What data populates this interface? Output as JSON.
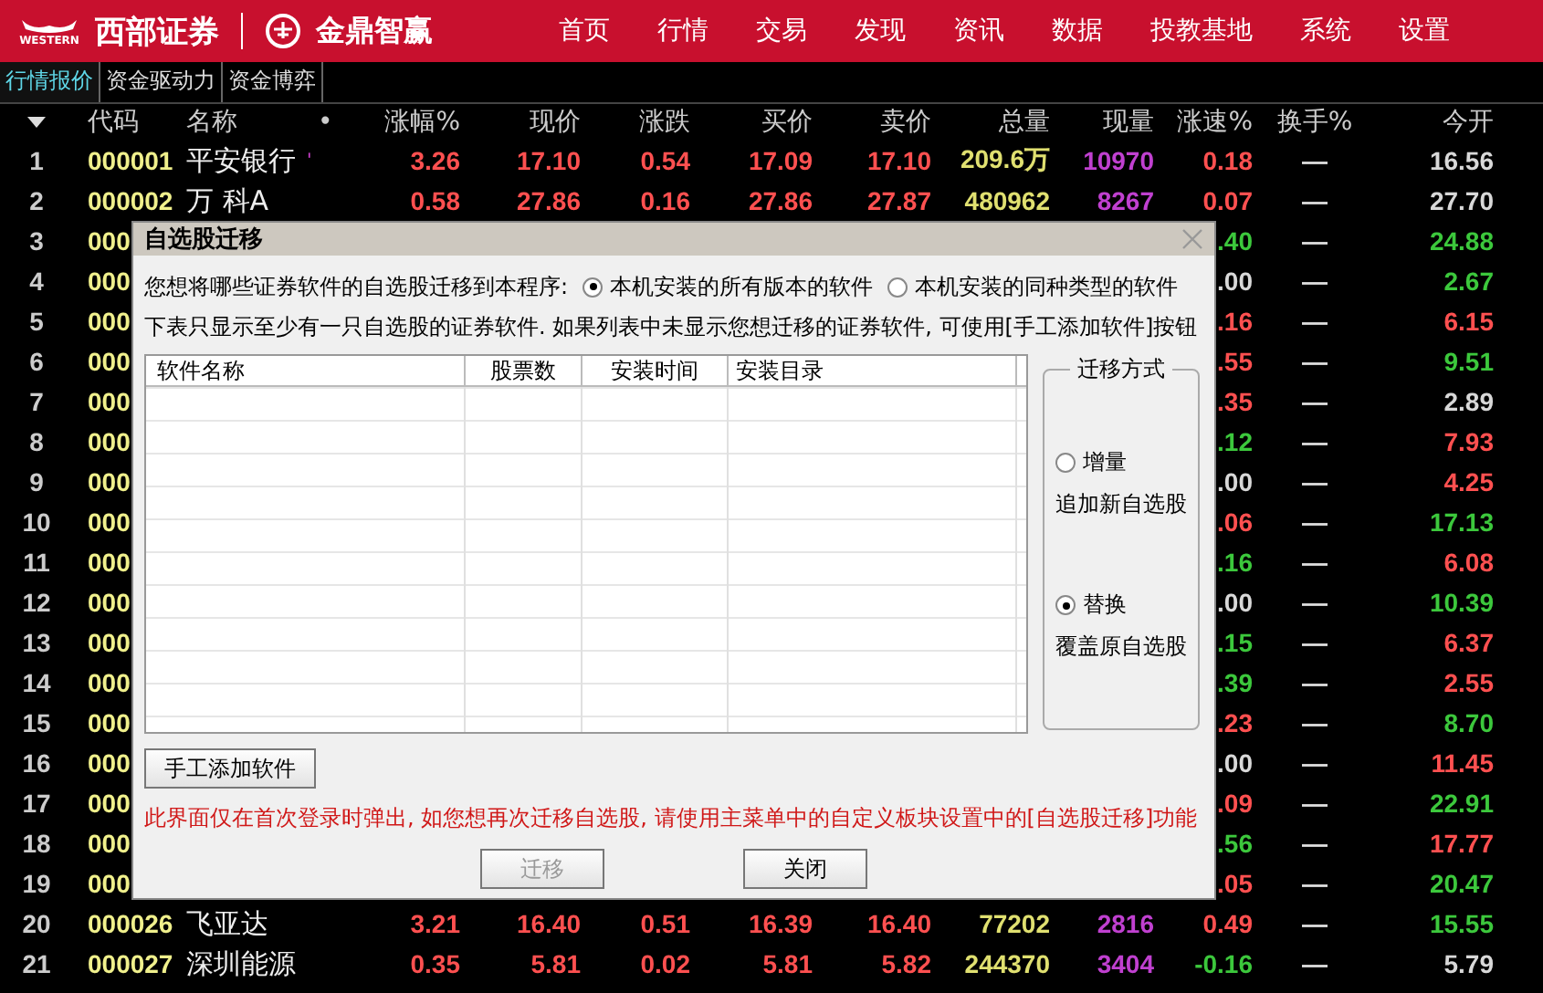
{
  "header": {
    "brand_small": "WESTERN",
    "brand": "西部证券",
    "product": "金鼎智赢",
    "nav": [
      "首页",
      "行情",
      "交易",
      "发现",
      "资讯",
      "数据",
      "投教基地",
      "系统",
      "设置"
    ]
  },
  "tabs": [
    {
      "label": "行情报价",
      "selected": true
    },
    {
      "label": "资金驱动力",
      "selected": false
    },
    {
      "label": "资金博弈",
      "selected": false
    }
  ],
  "table": {
    "columns": [
      "代码",
      "名称",
      "•",
      "涨幅%",
      "现价",
      "涨跌",
      "买价",
      "卖价",
      "总量",
      "现量",
      "涨速%",
      "换手%",
      "今开"
    ],
    "rows": [
      {
        "num": "1",
        "code": "000001",
        "name": "平安银行",
        "flag": "'",
        "color": "#ff5050",
        "chg_pct": "3.26",
        "price": "17.10",
        "chg": "0.54",
        "bid": "17.09",
        "ask": "17.10",
        "volume": "209.6万",
        "cur_vol": "10970",
        "speed": {
          "text": "0.18",
          "color": "#ff5050"
        },
        "turnover": "—",
        "open": {
          "text": "16.56",
          "color": "#d8d8d8"
        }
      },
      {
        "num": "2",
        "code": "000002",
        "name": "万 科A",
        "color": "#ff5050",
        "chg_pct": "0.58",
        "price": "27.86",
        "chg": "0.16",
        "bid": "27.86",
        "ask": "27.87",
        "volume": "480962",
        "cur_vol": "8267",
        "speed": {
          "text": "0.07",
          "color": "#ff5050"
        },
        "turnover": "—",
        "open": {
          "text": "27.70",
          "color": "#d8d8d8"
        }
      },
      {
        "num": "3",
        "code": "000",
        "speed": {
          "text": ".40",
          "color": "#3cc83c"
        },
        "turnover": "—",
        "open": {
          "text": "24.88",
          "color": "#3cc83c"
        }
      },
      {
        "num": "4",
        "code": "000",
        "speed": {
          "text": ".00",
          "color": "#d8d8d8"
        },
        "turnover": "—",
        "open": {
          "text": "2.67",
          "color": "#3cc83c"
        }
      },
      {
        "num": "5",
        "code": "000",
        "speed": {
          "text": ".16",
          "color": "#ff5050"
        },
        "turnover": "—",
        "open": {
          "text": "6.15",
          "color": "#ff5050"
        }
      },
      {
        "num": "6",
        "code": "000",
        "speed": {
          "text": ".55",
          "color": "#ff5050"
        },
        "turnover": "—",
        "open": {
          "text": "9.51",
          "color": "#3cc83c"
        }
      },
      {
        "num": "7",
        "code": "000",
        "speed": {
          "text": ".35",
          "color": "#ff5050"
        },
        "turnover": "—",
        "open": {
          "text": "2.89",
          "color": "#d8d8d8"
        }
      },
      {
        "num": "8",
        "code": "000",
        "speed": {
          "text": ".12",
          "color": "#3cc83c"
        },
        "turnover": "—",
        "open": {
          "text": "7.93",
          "color": "#ff5050"
        }
      },
      {
        "num": "9",
        "code": "000",
        "speed": {
          "text": ".00",
          "color": "#d8d8d8"
        },
        "turnover": "—",
        "open": {
          "text": "4.25",
          "color": "#ff5050"
        }
      },
      {
        "num": "10",
        "code": "000",
        "speed": {
          "text": ".06",
          "color": "#ff5050"
        },
        "turnover": "—",
        "open": {
          "text": "17.13",
          "color": "#3cc83c"
        }
      },
      {
        "num": "11",
        "code": "000",
        "speed": {
          "text": ".16",
          "color": "#3cc83c"
        },
        "turnover": "—",
        "open": {
          "text": "6.08",
          "color": "#ff5050"
        }
      },
      {
        "num": "12",
        "code": "000",
        "speed": {
          "text": ".00",
          "color": "#d8d8d8"
        },
        "turnover": "—",
        "open": {
          "text": "10.39",
          "color": "#3cc83c"
        }
      },
      {
        "num": "13",
        "code": "000",
        "speed": {
          "text": ".15",
          "color": "#3cc83c"
        },
        "turnover": "—",
        "open": {
          "text": "6.37",
          "color": "#ff5050"
        }
      },
      {
        "num": "14",
        "code": "000",
        "speed": {
          "text": ".39",
          "color": "#3cc83c"
        },
        "turnover": "—",
        "open": {
          "text": "2.55",
          "color": "#ff5050"
        }
      },
      {
        "num": "15",
        "code": "000",
        "speed": {
          "text": ".23",
          "color": "#ff5050"
        },
        "turnover": "—",
        "open": {
          "text": "8.70",
          "color": "#3cc83c"
        }
      },
      {
        "num": "16",
        "code": "000",
        "speed": {
          "text": ".00",
          "color": "#d8d8d8"
        },
        "turnover": "—",
        "open": {
          "text": "11.45",
          "color": "#ff5050"
        }
      },
      {
        "num": "17",
        "code": "000",
        "speed": {
          "text": ".09",
          "color": "#ff5050"
        },
        "turnover": "—",
        "open": {
          "text": "22.91",
          "color": "#3cc83c"
        }
      },
      {
        "num": "18",
        "code": "000",
        "speed": {
          "text": ".56",
          "color": "#3cc83c"
        },
        "turnover": "—",
        "open": {
          "text": "17.77",
          "color": "#ff5050"
        }
      },
      {
        "num": "19",
        "code": "000",
        "speed": {
          "text": ".05",
          "color": "#ff5050"
        },
        "turnover": "—",
        "open": {
          "text": "20.47",
          "color": "#3cc83c"
        }
      },
      {
        "num": "20",
        "code": "000026",
        "name": "飞亚达",
        "color": "#ff5050",
        "chg_pct": "3.21",
        "price": "16.40",
        "chg": "0.51",
        "bid": "16.39",
        "ask": "16.40",
        "volume": "77202",
        "cur_vol": "2816",
        "speed": {
          "text": "0.49",
          "color": "#ff5050"
        },
        "turnover": "—",
        "open": {
          "text": "15.55",
          "color": "#3cc83c"
        }
      },
      {
        "num": "21",
        "code": "000027",
        "name": "深圳能源",
        "color": "#ff5050",
        "chg_pct": "0.35",
        "price": "5.81",
        "chg": "0.02",
        "bid": "5.81",
        "ask": "5.82",
        "volume": "244370",
        "cur_vol": "3404",
        "speed": {
          "text": "-0.16",
          "color": "#3cc83c"
        },
        "turnover": "—",
        "open": {
          "text": "5.79",
          "color": "#d8d8d8"
        }
      }
    ]
  },
  "dialog": {
    "title": "自选股迁移",
    "prompt": "您想将哪些证券软件的自选股迁移到本程序:",
    "sources": [
      {
        "label": "本机安装的所有版本的软件",
        "selected": true
      },
      {
        "label": "本机安装的同种类型的软件",
        "selected": false
      }
    ],
    "hint": "下表只显示至少有一只自选股的证券软件. 如果列表中未显示您想迁移的证券软件, 可使用[手工添加软件]按钮",
    "list_columns": [
      "软件名称",
      "股票数",
      "安装时间",
      "安装目录"
    ],
    "mode": {
      "title": "迁移方式",
      "options": [
        {
          "label": "增量",
          "description": "追加新自选股",
          "selected": false
        },
        {
          "label": "替换",
          "description": "覆盖原自选股",
          "selected": true
        }
      ]
    },
    "add_button": "手工添加软件",
    "note": "此界面仅在首次登录时弹出, 如您想再次迁移自选股, 请使用主菜单中的自定义板块设置中的[自选股迁移]功能",
    "buttons": [
      {
        "label": "迁移",
        "disabled": true
      },
      {
        "label": "关闭",
        "disabled": false
      }
    ]
  }
}
